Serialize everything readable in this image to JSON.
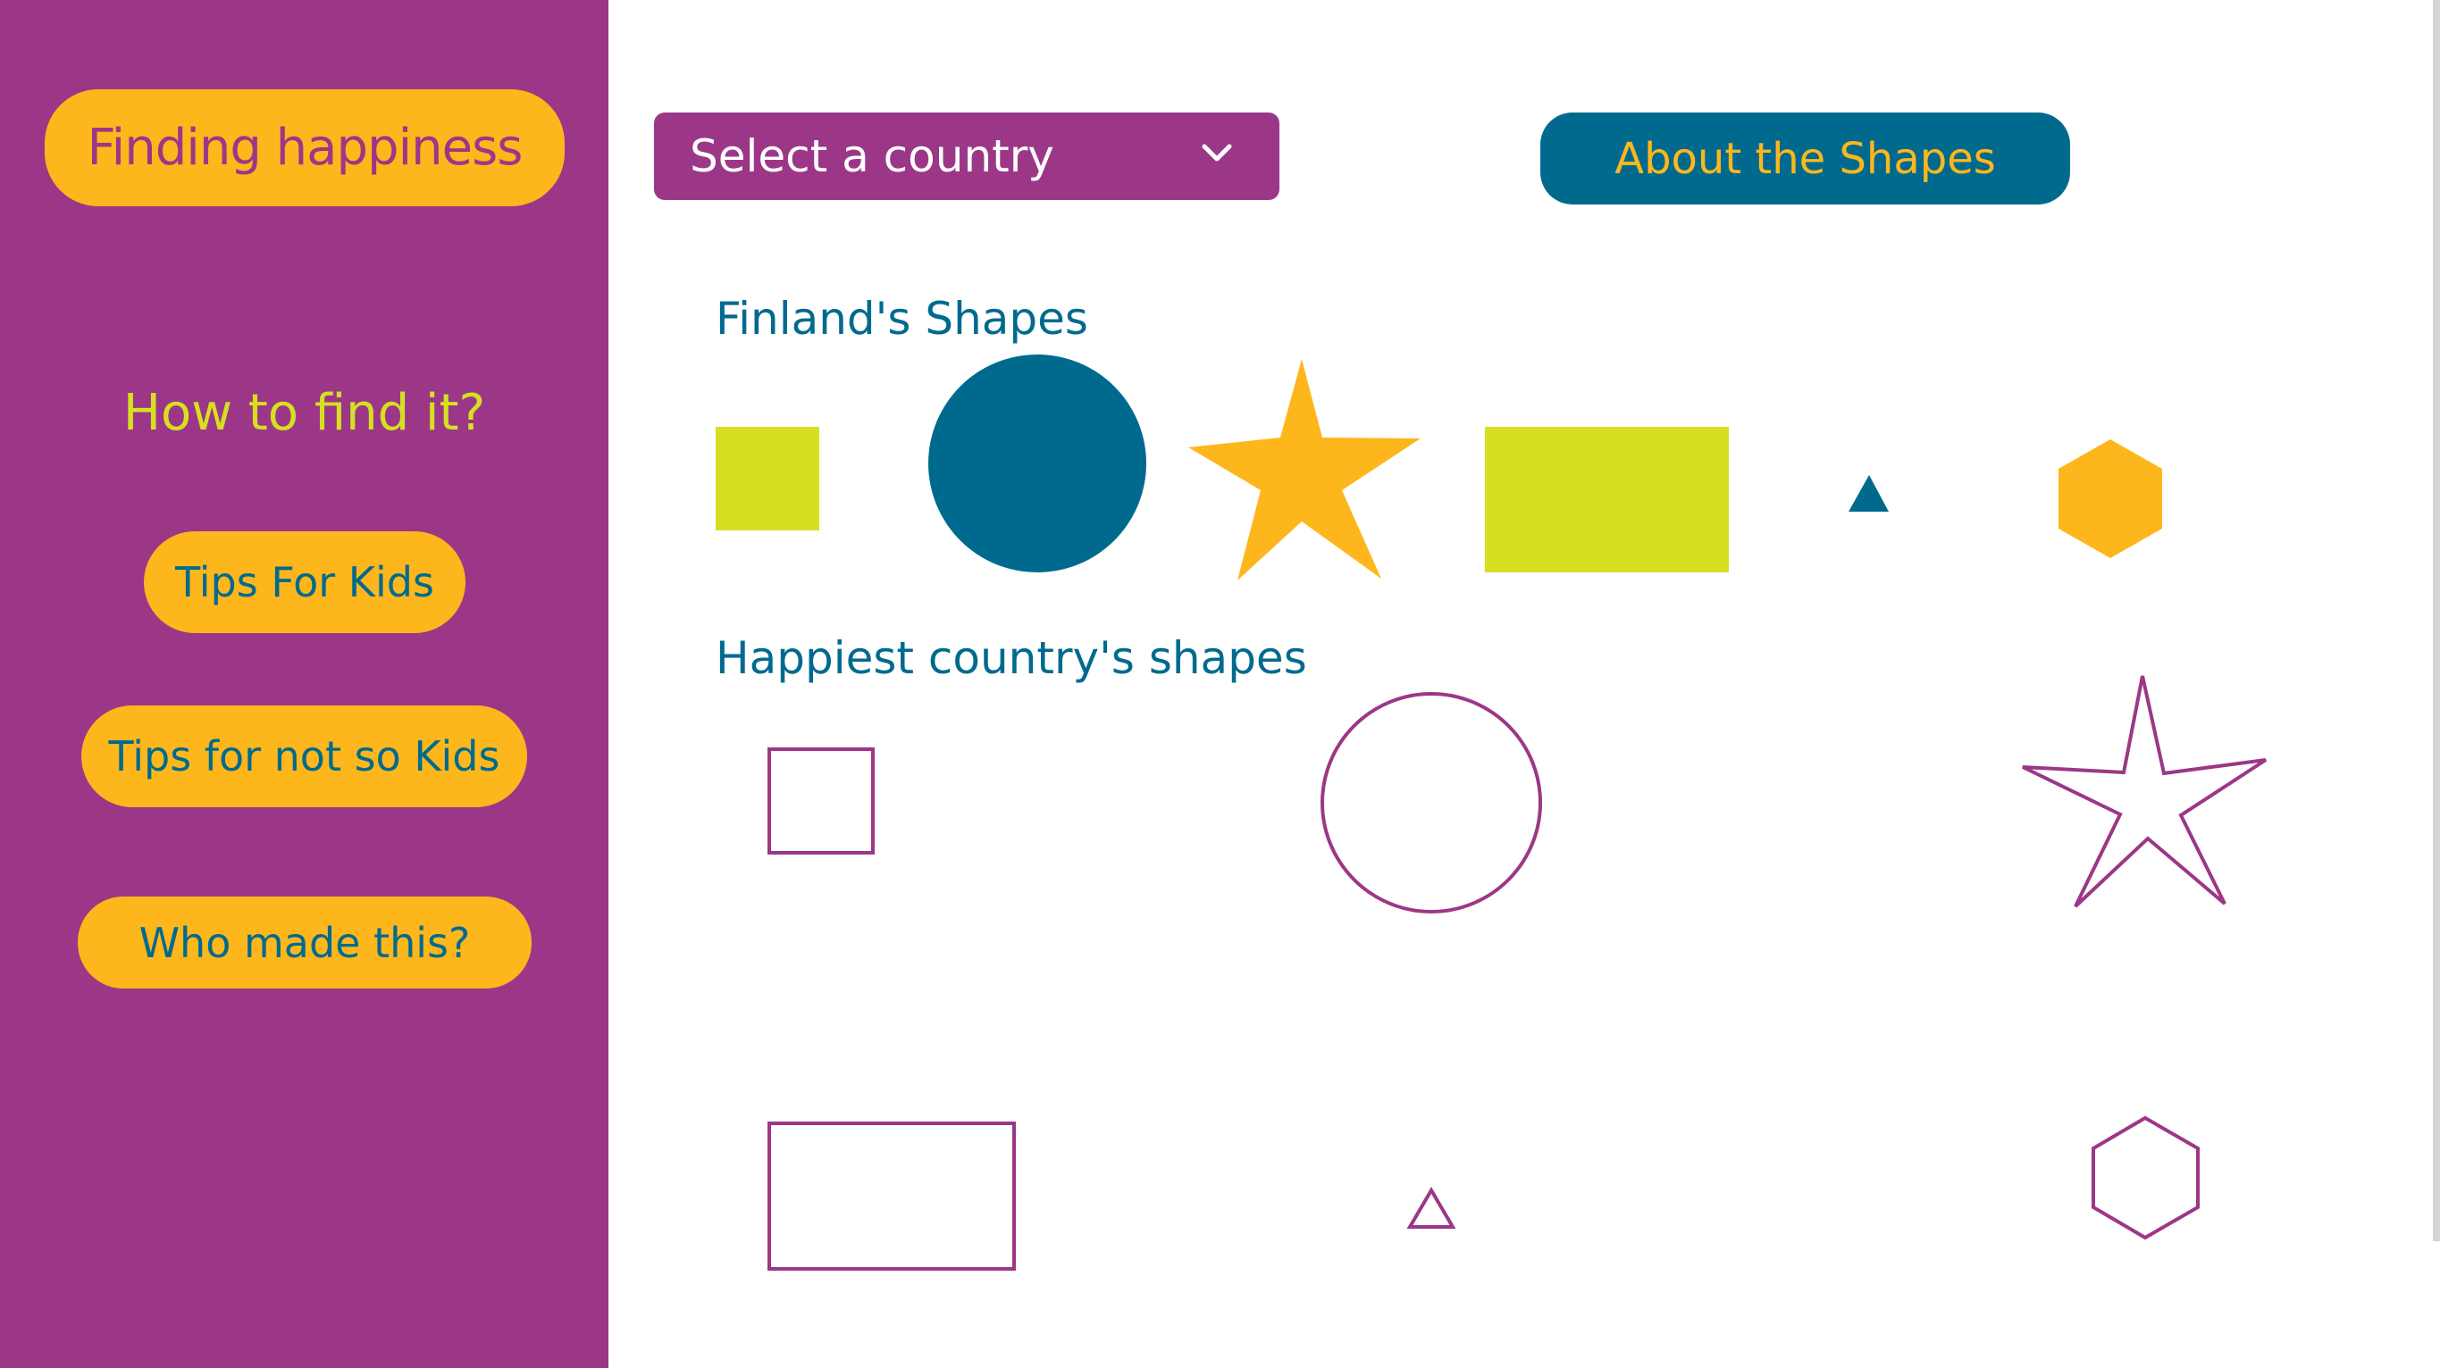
{
  "sidebar": {
    "brand_label": "Finding happiness",
    "heading": "How to find it?",
    "items": [
      {
        "label": "Tips For Kids"
      },
      {
        "label": "Tips for not so Kids"
      },
      {
        "label": "Who made this?"
      }
    ]
  },
  "toolbar": {
    "country_select_value": "Select a country",
    "about_label": "About the Shapes"
  },
  "sections": {
    "finland_title": "Finland's Shapes",
    "happiest_title": "Happiest country's shapes"
  },
  "colors": {
    "purple": "#9c3787",
    "yellow": "#fdb71c",
    "lime": "#d6e021",
    "teal": "#006a8e"
  },
  "shapes": {
    "finland": [
      "square",
      "circle",
      "star",
      "rectangle",
      "triangle",
      "hexagon"
    ],
    "happiest": [
      "square",
      "circle",
      "star",
      "rectangle",
      "triangle",
      "hexagon"
    ]
  }
}
